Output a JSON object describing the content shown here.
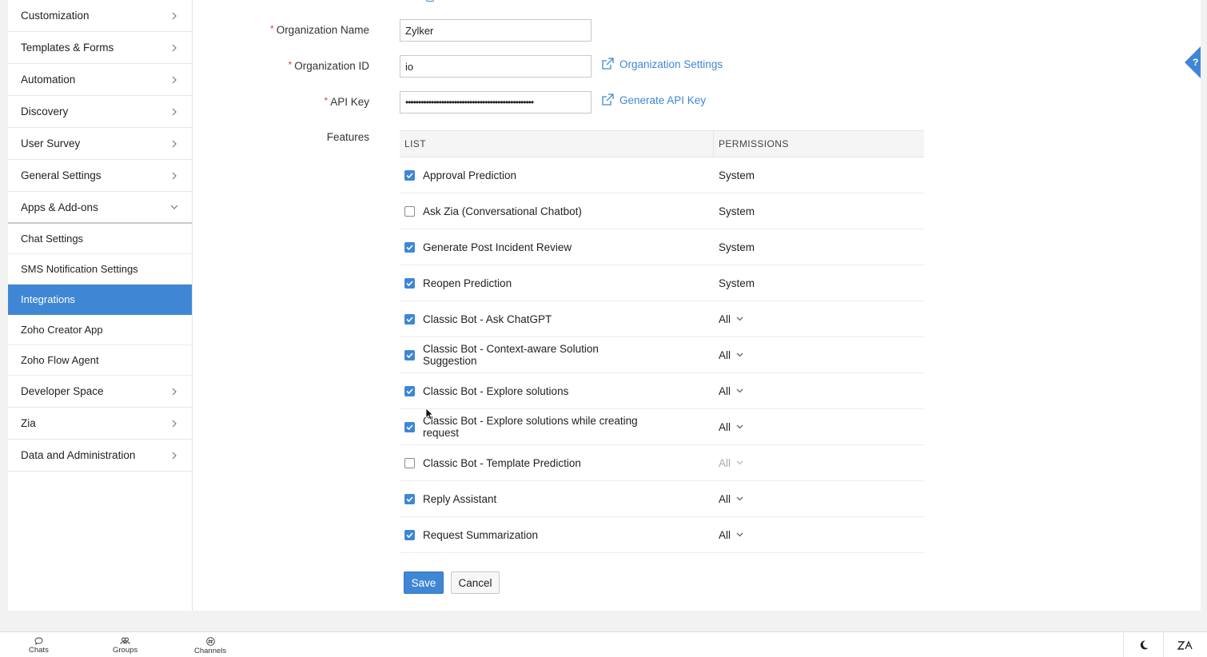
{
  "sidebar": {
    "items_top": [
      {
        "label": "Customization"
      },
      {
        "label": "Templates & Forms"
      },
      {
        "label": "Automation"
      },
      {
        "label": "Discovery"
      },
      {
        "label": "User Survey"
      },
      {
        "label": "General Settings"
      }
    ],
    "open_group": {
      "label": "Apps & Add-ons"
    },
    "sub_items": [
      {
        "label": "Chat Settings"
      },
      {
        "label": "SMS Notification Settings"
      },
      {
        "label": "Integrations",
        "active": true
      },
      {
        "label": "Zoho Creator App"
      },
      {
        "label": "Zoho Flow Agent"
      }
    ],
    "items_bottom": [
      {
        "label": "Developer Space"
      },
      {
        "label": "Zia"
      },
      {
        "label": "Data and Administration"
      }
    ]
  },
  "form": {
    "org_name": {
      "label": "Organization Name",
      "required": "*",
      "value": "Zylker"
    },
    "org_id": {
      "label": "Organization ID",
      "required": "*",
      "value": "io",
      "link": "Organization Settings"
    },
    "api_key": {
      "label": "API Key",
      "required": "*",
      "value": "••••••••••••••••••••••••••••••••••••••••••••••••••",
      "link": "Generate API Key"
    },
    "features_label": "Features"
  },
  "features": {
    "col_list": "LIST",
    "col_permissions": "PERMISSIONS",
    "rows": [
      {
        "name": "Approval Prediction",
        "checked": true,
        "permission": "System",
        "select": false
      },
      {
        "name": "Ask Zia (Conversational Chatbot)",
        "checked": false,
        "permission": "System",
        "select": false
      },
      {
        "name": "Generate Post Incident Review",
        "checked": true,
        "permission": "System",
        "select": false
      },
      {
        "name": "Reopen Prediction",
        "checked": true,
        "permission": "System",
        "select": false
      },
      {
        "name": "Classic Bot - Ask ChatGPT",
        "checked": true,
        "permission": "All",
        "select": true
      },
      {
        "name": "Classic Bot - Context-aware Solution Suggestion",
        "checked": true,
        "permission": "All",
        "select": true
      },
      {
        "name": "Classic Bot - Explore solutions",
        "checked": true,
        "permission": "All",
        "select": true
      },
      {
        "name": "Classic Bot - Explore solutions while creating request",
        "checked": true,
        "permission": "All",
        "select": true
      },
      {
        "name": "Classic Bot - Template Prediction",
        "checked": false,
        "permission": "All",
        "select": true,
        "disabled": true
      },
      {
        "name": "Reply Assistant",
        "checked": true,
        "permission": "All",
        "select": true
      },
      {
        "name": "Request Summarization",
        "checked": true,
        "permission": "All",
        "select": true
      }
    ]
  },
  "actions": {
    "save": "Save",
    "cancel": "Cancel"
  },
  "footer": {
    "chats": "Chats",
    "groups": "Groups",
    "channels": "Channels"
  },
  "colors": {
    "accent": "#3f87d4",
    "required": "#e0403a"
  }
}
